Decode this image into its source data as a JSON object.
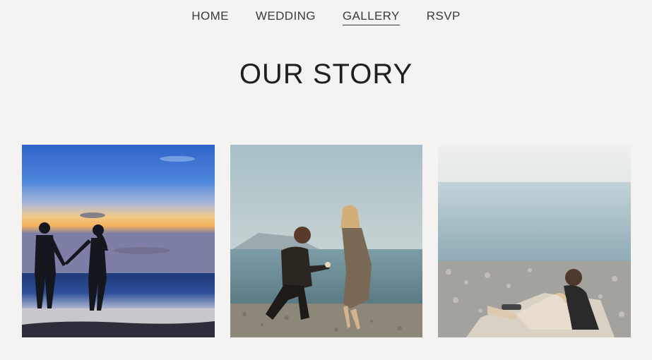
{
  "nav": {
    "items": [
      {
        "label": "HOME",
        "active": false
      },
      {
        "label": "WEDDING",
        "active": false
      },
      {
        "label": "GALLERY",
        "active": true
      },
      {
        "label": "RSVP",
        "active": false
      }
    ]
  },
  "page_title": "OUR STORY",
  "gallery": {
    "photos": [
      {
        "subject": "couple-silhouette-sunset-beach-photo"
      },
      {
        "subject": "beach-proposal-photo"
      },
      {
        "subject": "couple-pebble-beach-picnic-photo"
      }
    ]
  },
  "colors": {
    "background": "#f4f3f2",
    "text": "#2a2a2a"
  }
}
